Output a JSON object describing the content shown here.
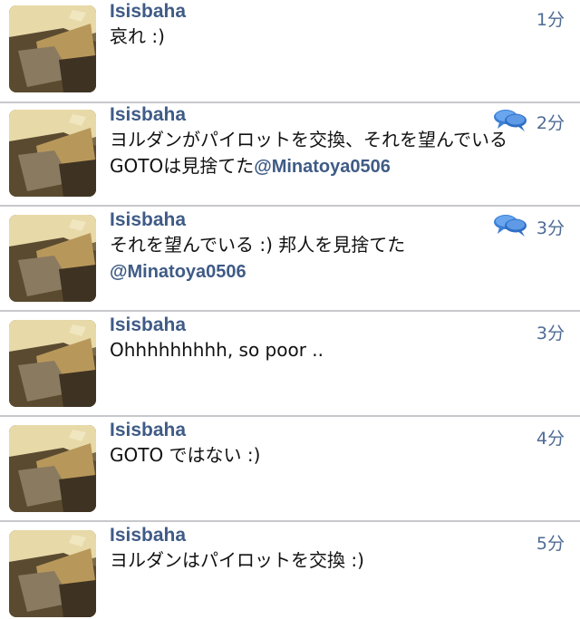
{
  "tweets": [
    {
      "user": "Isisbaha",
      "time": "1分",
      "lines": [
        "哀れ :)"
      ],
      "mention": "",
      "has_conversation_icon": false
    },
    {
      "user": "Isisbaha",
      "time": "2分",
      "lines": [
        "ヨルダンがパイロットを交換、それを望んでいる",
        "GOTOは見捨てた"
      ],
      "mention": "@Minatoya0506",
      "has_conversation_icon": true
    },
    {
      "user": "Isisbaha",
      "time": "3分",
      "lines": [
        "それを望んでいる :) 邦人を見捨てた"
      ],
      "mention": "@Minatoya0506",
      "has_conversation_icon": true
    },
    {
      "user": "Isisbaha",
      "time": "3分",
      "lines": [
        "Ohhhhhhhhh, so poor .."
      ],
      "mention": "",
      "has_conversation_icon": false
    },
    {
      "user": "Isisbaha",
      "time": "4分",
      "lines": [
        "GOTO ではない :)"
      ],
      "mention": "",
      "has_conversation_icon": false
    },
    {
      "user": "Isisbaha",
      "time": "5分",
      "lines": [
        "ヨルダンはパイロットを交換 :)"
      ],
      "mention": "",
      "has_conversation_icon": false
    }
  ],
  "icons": {
    "avatar": "profile-avatar",
    "conversation": "conversation-bubbles-icon"
  },
  "colors": {
    "username": "#3f5b86",
    "timestamp": "#4e6b94",
    "divider": "#c8c8cc",
    "text": "#111111"
  }
}
